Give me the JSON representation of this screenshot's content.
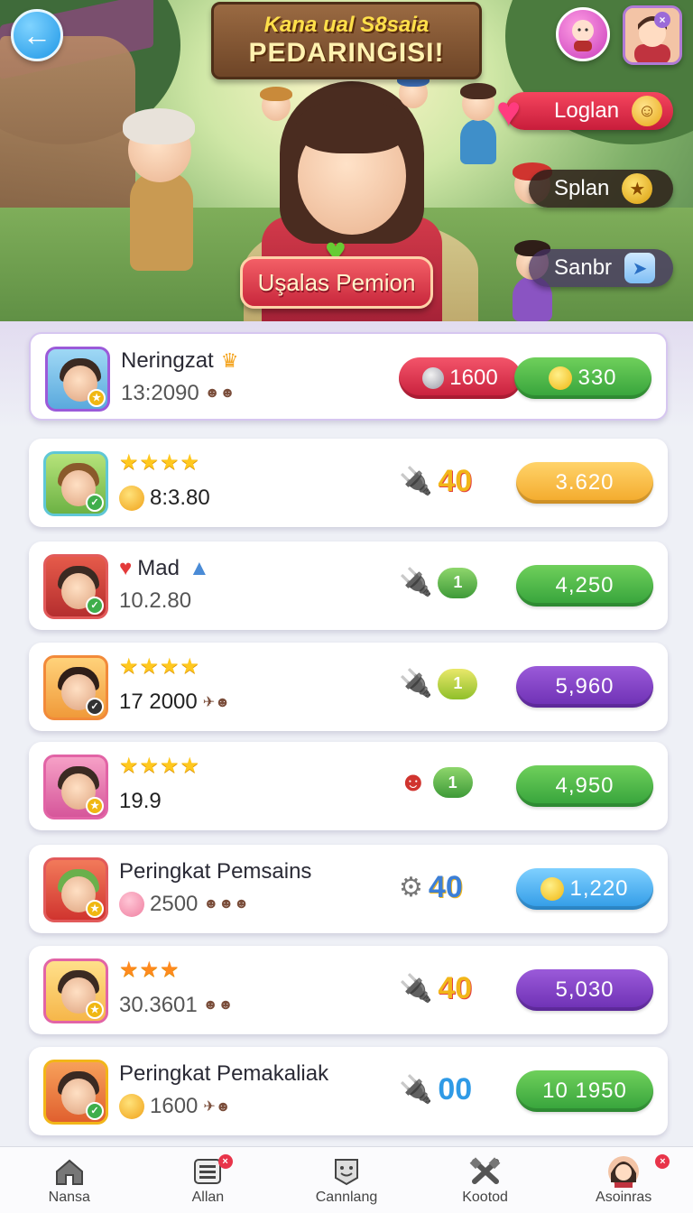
{
  "header": {
    "title_line1": "Kana ual S8saia",
    "title_line2": "PEDARINGISI!",
    "back_icon": "arrow-left-icon",
    "ribbon_label": "Uşalas Pemion",
    "side_buttons": [
      {
        "label": "Loglan",
        "icon": "smiley-coin-icon",
        "color": "#e32a46"
      },
      {
        "label": "Splan",
        "icon": "star-coin-icon",
        "color": "#2d1e19"
      },
      {
        "label": "Sanbr",
        "icon": "paper-plane-icon",
        "color": "#46326a"
      }
    ]
  },
  "rows": [
    {
      "name": "Neringzat",
      "stars": "",
      "sub": "13:2090",
      "red_value": "1600",
      "score": "330",
      "score_color": "green",
      "score_coin": true
    },
    {
      "name": "",
      "stars": "★★★★",
      "sub": "8:3.80",
      "tool_count": "40",
      "score": "3.620",
      "score_color": "orange"
    },
    {
      "name": "Mad",
      "stars": "",
      "sub": "10.2.80",
      "tool_badge": "1",
      "score": "4,250",
      "score_color": "green"
    },
    {
      "name": "",
      "stars": "★★★★",
      "sub": "17 2000",
      "tool_badge": "1",
      "score": "5,960",
      "score_color": "purple"
    },
    {
      "name": "",
      "stars": "★★★★",
      "sub": "19.9",
      "tool_badge": "1",
      "score": "4,950",
      "score_color": "green"
    },
    {
      "name": "Peringkat Pemsains",
      "stars": "",
      "sub": "2500",
      "tool_count": "40",
      "score": "1,220",
      "score_color": "blue",
      "score_coin": true
    },
    {
      "name": "",
      "stars": "★★★",
      "sub": "30.3601",
      "tool_count": "40",
      "score": "5,030",
      "score_color": "purple"
    },
    {
      "name": "Peringkat Pemakaliak",
      "stars": "",
      "sub": "1600",
      "tool_count": "00",
      "score": "10 1950",
      "score_color": "green"
    }
  ],
  "nav": [
    {
      "label": "Nansa",
      "icon": "home-icon",
      "badge": ""
    },
    {
      "label": "Allan",
      "icon": "list-icon",
      "badge": "×"
    },
    {
      "label": "Cannlang",
      "icon": "smile-badge-icon",
      "badge": ""
    },
    {
      "label": "Kootod",
      "icon": "crossed-tools-icon",
      "badge": ""
    },
    {
      "label": "Asoinras",
      "icon": "avatar-icon",
      "badge": "×"
    }
  ]
}
